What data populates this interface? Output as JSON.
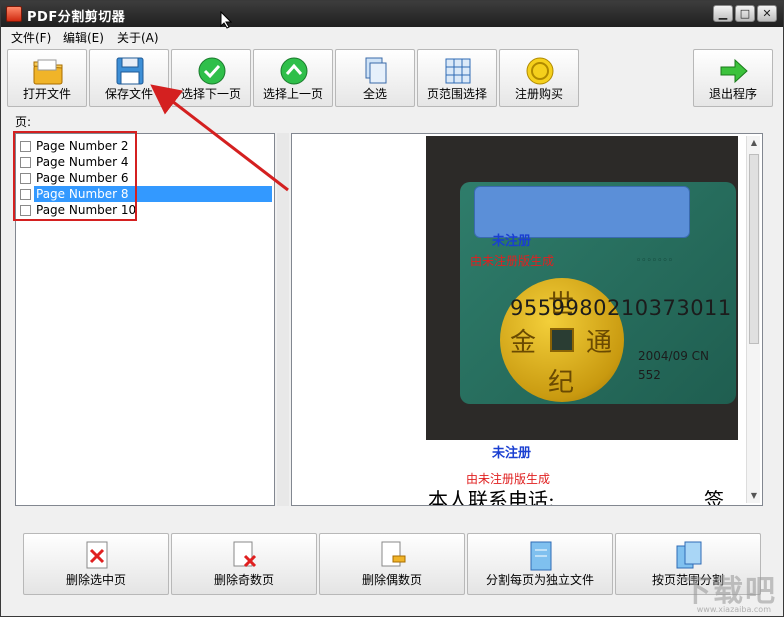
{
  "window": {
    "title": "PDF分割剪切器",
    "buttons": {
      "minimize": "▁",
      "maximize": "□",
      "close": "✕"
    }
  },
  "menu": [
    {
      "label": "文件(F)"
    },
    {
      "label": "编辑(E)"
    },
    {
      "label": "关于(A)"
    }
  ],
  "toolbar": {
    "open_label": "打开文件",
    "save_label": "保存文件",
    "select_next_label": "选择下一页",
    "select_prev_label": "选择上一页",
    "select_all_label": "全选",
    "range_select_label": "页范围选择",
    "register_label": "注册购买",
    "exit_label": "退出程序"
  },
  "pages_panel": {
    "label": "页:",
    "items": [
      {
        "label": "Page Number 2",
        "checked": false,
        "selected": false
      },
      {
        "label": "Page Number 4",
        "checked": false,
        "selected": false
      },
      {
        "label": "Page Number 6",
        "checked": false,
        "selected": false
      },
      {
        "label": "Page Number 8",
        "checked": false,
        "selected": true
      },
      {
        "label": "Page Number 10",
        "checked": false,
        "selected": false
      }
    ]
  },
  "preview": {
    "card_number": "9559980210373011",
    "card_date": "2004/09 CN",
    "card_code": "552",
    "watermark_unregistered": "未注册",
    "watermark_unregistered_2": "未注册",
    "watermark_trial_overlay": "由未注册版生成",
    "watermark_trial": "由未注册版生成",
    "contact_text": "本人联系电话:",
    "sign_text": "签"
  },
  "bottom": {
    "delete_selected_label": "删除选中页",
    "delete_odd_label": "删除奇数页",
    "delete_even_label": "删除偶数页",
    "split_each_label": "分割每页为独立文件",
    "split_range_label": "按页范围分割"
  },
  "colors": {
    "selection": "#3399ff",
    "annotation_red": "#d42020",
    "titlebar": "#2a2a2a"
  }
}
